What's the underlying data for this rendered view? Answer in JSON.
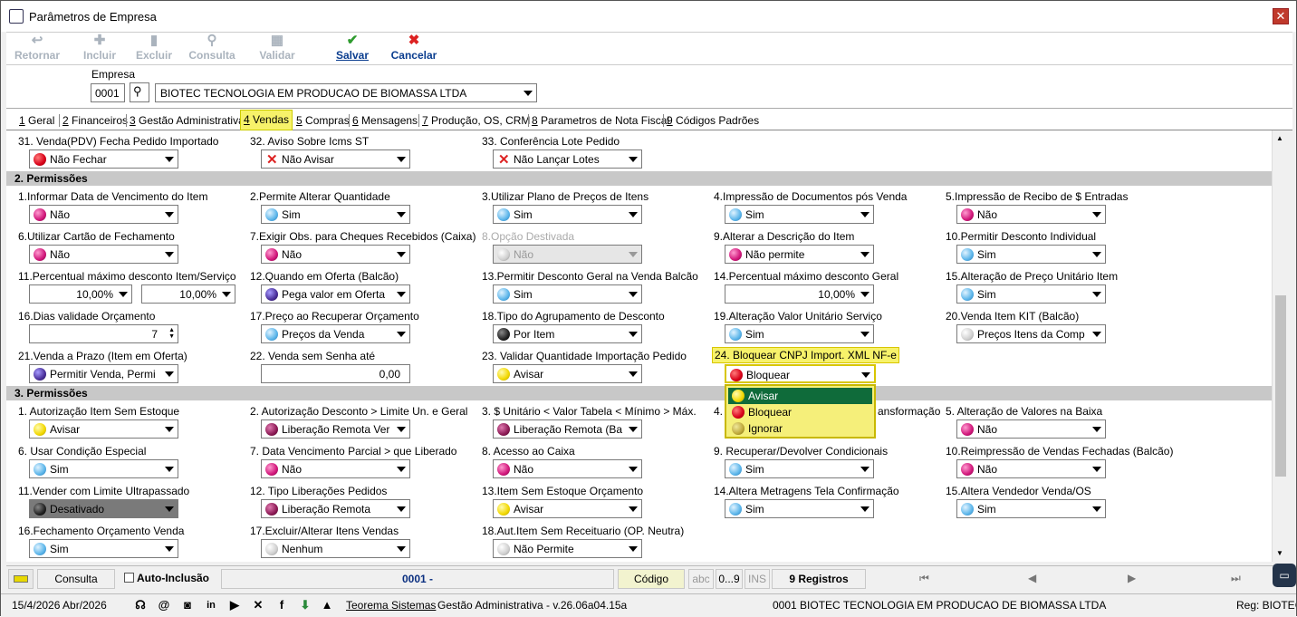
{
  "window": {
    "title": "Parâmetros de Empresa",
    "close_label": "✕"
  },
  "toolbar": {
    "retornar": "Retornar",
    "incluir": "Incluir",
    "excluir": "Excluir",
    "consulta": "Consulta",
    "validar": "Validar",
    "salvar": "Salvar",
    "cancelar": "Cancelar"
  },
  "empresa": {
    "label": "Empresa",
    "code": "0001",
    "name": "BIOTEC TECNOLOGIA EM PRODUCAO DE BIOMASSA LTDA"
  },
  "tabs": [
    {
      "num": "1",
      "label": " Geral"
    },
    {
      "num": "2",
      "label": " Financeiros"
    },
    {
      "num": "3",
      "label": " Gestão Administrativa"
    },
    {
      "num": "4",
      "label": " Vendas"
    },
    {
      "num": "5",
      "label": " Compras"
    },
    {
      "num": "6",
      "label": " Mensagens"
    },
    {
      "num": "7",
      "label": " Produção, OS, CRM"
    },
    {
      "num": "8",
      "label": " Parametros de Nota Fiscal"
    },
    {
      "num": "9",
      "label": " Códigos Padrões"
    }
  ],
  "top_rows": {
    "l31": "31. Venda(PDV) Fecha Pedido Importado",
    "v31": "Não Fechar",
    "l32": "32. Aviso Sobre Icms ST",
    "v32": "Não Avisar",
    "l33": "33. Conferência Lote Pedido",
    "v33": "Não Lançar Lotes"
  },
  "section2": {
    "title": "2. Permissões",
    "l1": "1.Informar Data de Vencimento do Item",
    "v1": "Não",
    "l2": "2.Permite Alterar Quantidade",
    "v2": "Sim",
    "l3": "3.Utilizar Plano de Preços de Itens",
    "v3": "Sim",
    "l4": "4.Impressão de Documentos pós Venda",
    "v4": "Sim",
    "l5": "5.Impressão de Recibo de $ Entradas",
    "v5": "Não",
    "l6": "6.Utilizar Cartão de Fechamento",
    "v6": "Não",
    "l7": "7.Exigir Obs. para Cheques Recebidos (Caixa)",
    "v7": "Não",
    "l8": "8.Opção Destivada",
    "v8": "Não",
    "l9": "9.Alterar a Descrição do Item",
    "v9": "Não permite",
    "l10": "10.Permitir Desconto Individual",
    "v10": "Sim",
    "l11": "11.Percentual máximo desconto Item/Serviço",
    "v11a": "10,00%",
    "v11b": "10,00%",
    "l12": "12.Quando em Oferta (Balcão)",
    "v12": "Pega valor em Oferta",
    "l13": "13.Permitir Desconto Geral na Venda Balcão",
    "v13": "Sim",
    "l14": "14.Percentual máximo desconto Geral",
    "v14": "10,00%",
    "l15": "15.Alteração de Preço Unitário Item",
    "v15": "Sim",
    "l16": "16.Dias validade Orçamento",
    "v16": "7",
    "l17": "17.Preço ao Recuperar Orçamento",
    "v17": "Preços da Venda",
    "l18": "18.Tipo do Agrupamento de Desconto",
    "v18": "Por Item",
    "l19": "19.Alteração Valor Unitário Serviço",
    "v19": "Sim",
    "l20": "20.Venda Item KIT (Balcão)",
    "v20": "Preços Itens da Comp",
    "l21": "21.Venda a Prazo (Item em Oferta)",
    "v21": "Permitir Venda, Permi",
    "l22": "22. Venda sem Senha até",
    "v22": "0,00",
    "l23": "23. Validar Quantidade Importação Pedido",
    "v23": "Avisar",
    "l24": "24. Bloquear CNPJ Import. XML NF-e",
    "v24": "Bloquear"
  },
  "section3": {
    "title": "3. Permissões",
    "l1": "1. Autorização Item Sem Estoque",
    "v1": "Avisar",
    "l2": "2. Autorização Desconto > Limite Un. e Geral",
    "v2": "Liberação Remota Ver",
    "l3": "3. $ Unitário < Valor Tabela < Mínimo > Máx.",
    "v3": "Liberação Remota (Ba",
    "l4a": "4.",
    "l4b": "ansformação",
    "l5": "5. Alteração de Valores na Baixa",
    "v5": "Não",
    "l6": "6. Usar Condição Especial",
    "v6": "Sim",
    "l7": "7. Data Vencimento Parcial > que Liberado",
    "v7": "Não",
    "l8": "8. Acesso ao Caixa",
    "v8": "Não",
    "l9": "9. Recuperar/Devolver Condicionais",
    "v9": "Sim",
    "l10": "10.Reimpressão de Vendas Fechadas (Balcão)",
    "v10": "Não",
    "l11": "11.Vender com Limite Ultrapassado",
    "v11": "Desativado",
    "l12": "12. Tipo Liberações Pedidos",
    "v12": "Liberação Remota",
    "l13": "13.Item Sem Estoque Orçamento",
    "v13": "Avisar",
    "l14": "14.Altera Metragens Tela Confirmação",
    "v14": "Sim",
    "l15": "15.Altera Vendedor Venda/OS",
    "v15": "Sim",
    "l16": "16.Fechamento Orçamento Venda",
    "v16": "Sim",
    "l17": "17.Excluir/Alterar Itens Vendas",
    "v17": "Nenhum",
    "l18": "18.Aut.Item Sem Receituario (OP. Neutra)",
    "v18": "Não Permite"
  },
  "popup": {
    "items": [
      "Avisar",
      "Bloquear",
      "Ignorar"
    ]
  },
  "statusbar": {
    "consulta": "Consulta",
    "auto_inclusao": "Auto-Inclusão",
    "record": "0001 -",
    "codigo": "Código",
    "abc": "abc",
    "range": "0...9",
    "ins": "INS",
    "registros": "9 Registros"
  },
  "footer": {
    "date": "15/4/2026 Abr/2026",
    "teorema": "Teorema Sistemas",
    "version": "Gestão Administrativa - v.26.06a04.15a",
    "company": "0001 BIOTEC TECNOLOGIA EM PRODUCAO DE BIOMASSA LTDA",
    "reg": "Reg: BIOTEC"
  },
  "colors": {
    "accent_yellow": "#f7f26a",
    "section_gray": "#c8c8c8",
    "selected_green": "#0f6b3a"
  }
}
